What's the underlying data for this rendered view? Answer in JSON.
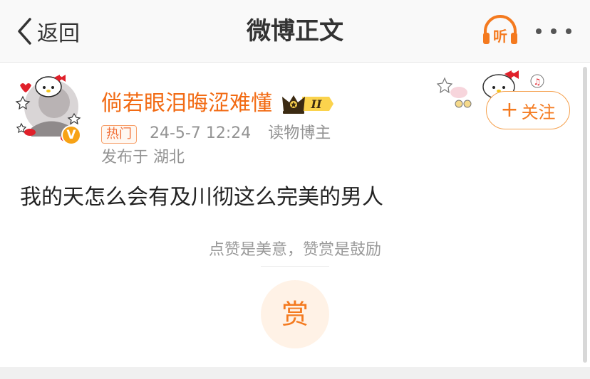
{
  "nav": {
    "back_label": "返回",
    "title": "微博正文",
    "listen_icon_label": "听",
    "listen_icon": "headphones-icon",
    "more_icon": "more-icon"
  },
  "author": {
    "name": "倘若眼泪晦涩难懂",
    "member_level": "II",
    "verified_mark": "V",
    "hot_badge": "热门",
    "timestamp": "24-5-7 12:24",
    "identity": "读物博主",
    "location": "发布于 湖北"
  },
  "follow": {
    "plus": "+",
    "label": "关注"
  },
  "post": {
    "text": "我的天怎么会有及川彻这么完美的男人"
  },
  "reward": {
    "tip": "点赞是美意，赞赏是鼓励",
    "button_label": "赏"
  },
  "colors": {
    "accent": "#f47a1f",
    "username": "#f26b14",
    "meta_gray": "#939393",
    "verified": "#f7a215"
  }
}
